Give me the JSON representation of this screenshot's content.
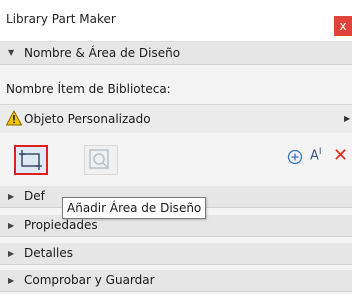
{
  "window": {
    "title": "Library Part Maker",
    "close_label": "x"
  },
  "section_main": {
    "label": "Nombre & Área de Diseño",
    "expanded": true
  },
  "library_item": {
    "label": "Nombre Ítem de Biblioteca:",
    "value": "Objeto Personalizado",
    "warning_icon": "warning-icon"
  },
  "toolbar": {
    "add_area_icon": "add-design-area-icon",
    "zoom_icon": "zoom-icon",
    "plus_icon": "plus-circle-icon",
    "ai_label": "A",
    "ai_sup": "I",
    "delete_label": "✕"
  },
  "tooltip": {
    "text": "Añadir Área de Diseño"
  },
  "sections": [
    {
      "label": "Def"
    },
    {
      "label": "Propiedades"
    },
    {
      "label": "Detalles"
    },
    {
      "label": "Comprobar y Guardar"
    }
  ],
  "colors": {
    "accent_red": "#e02020",
    "highlight_blue": "#dfe9f3",
    "icon_blue": "#3a76c4"
  }
}
